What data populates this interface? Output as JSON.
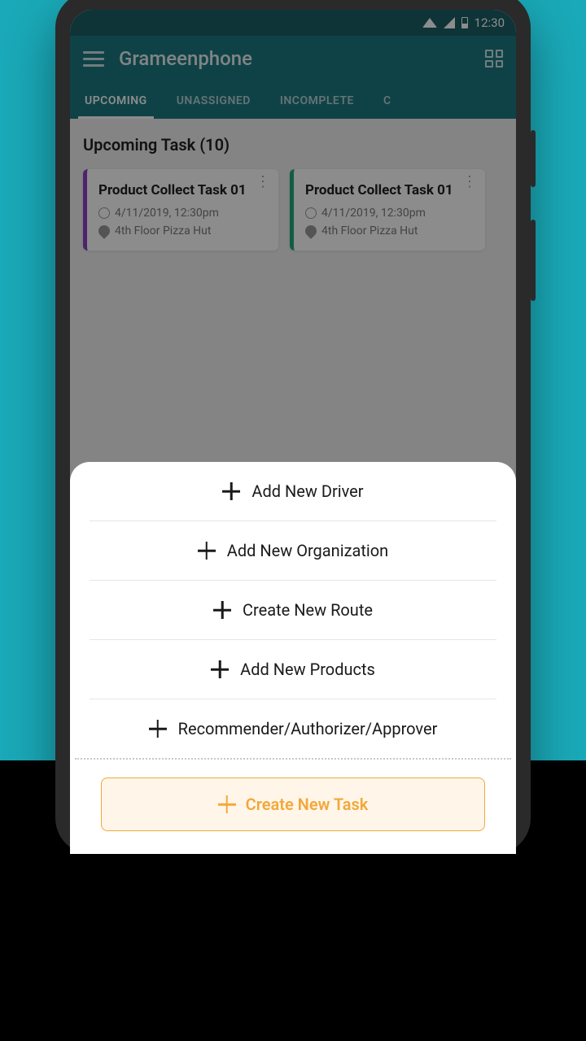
{
  "status": {
    "time": "12:30"
  },
  "header": {
    "title": "Grameenphone"
  },
  "tabs": [
    "UPCOMING",
    "UNASSIGNED",
    "INCOMPLETE",
    "C"
  ],
  "section_title": "Upcoming Task (10)",
  "cards": [
    {
      "title": "Product Collect Task 01",
      "datetime": "4/11/2019, 12:30pm",
      "location": "4th Floor Pizza Hut"
    },
    {
      "title": "Product Collect Task 01",
      "datetime": "4/11/2019, 12:30pm",
      "location": "4th Floor Pizza Hut"
    }
  ],
  "sheet": {
    "items": [
      "Add New Driver",
      "Add New Organization",
      "Create New Route",
      "Add New Products",
      "Recommender/Authorizer/Approver"
    ],
    "primary": "Create New Task"
  }
}
